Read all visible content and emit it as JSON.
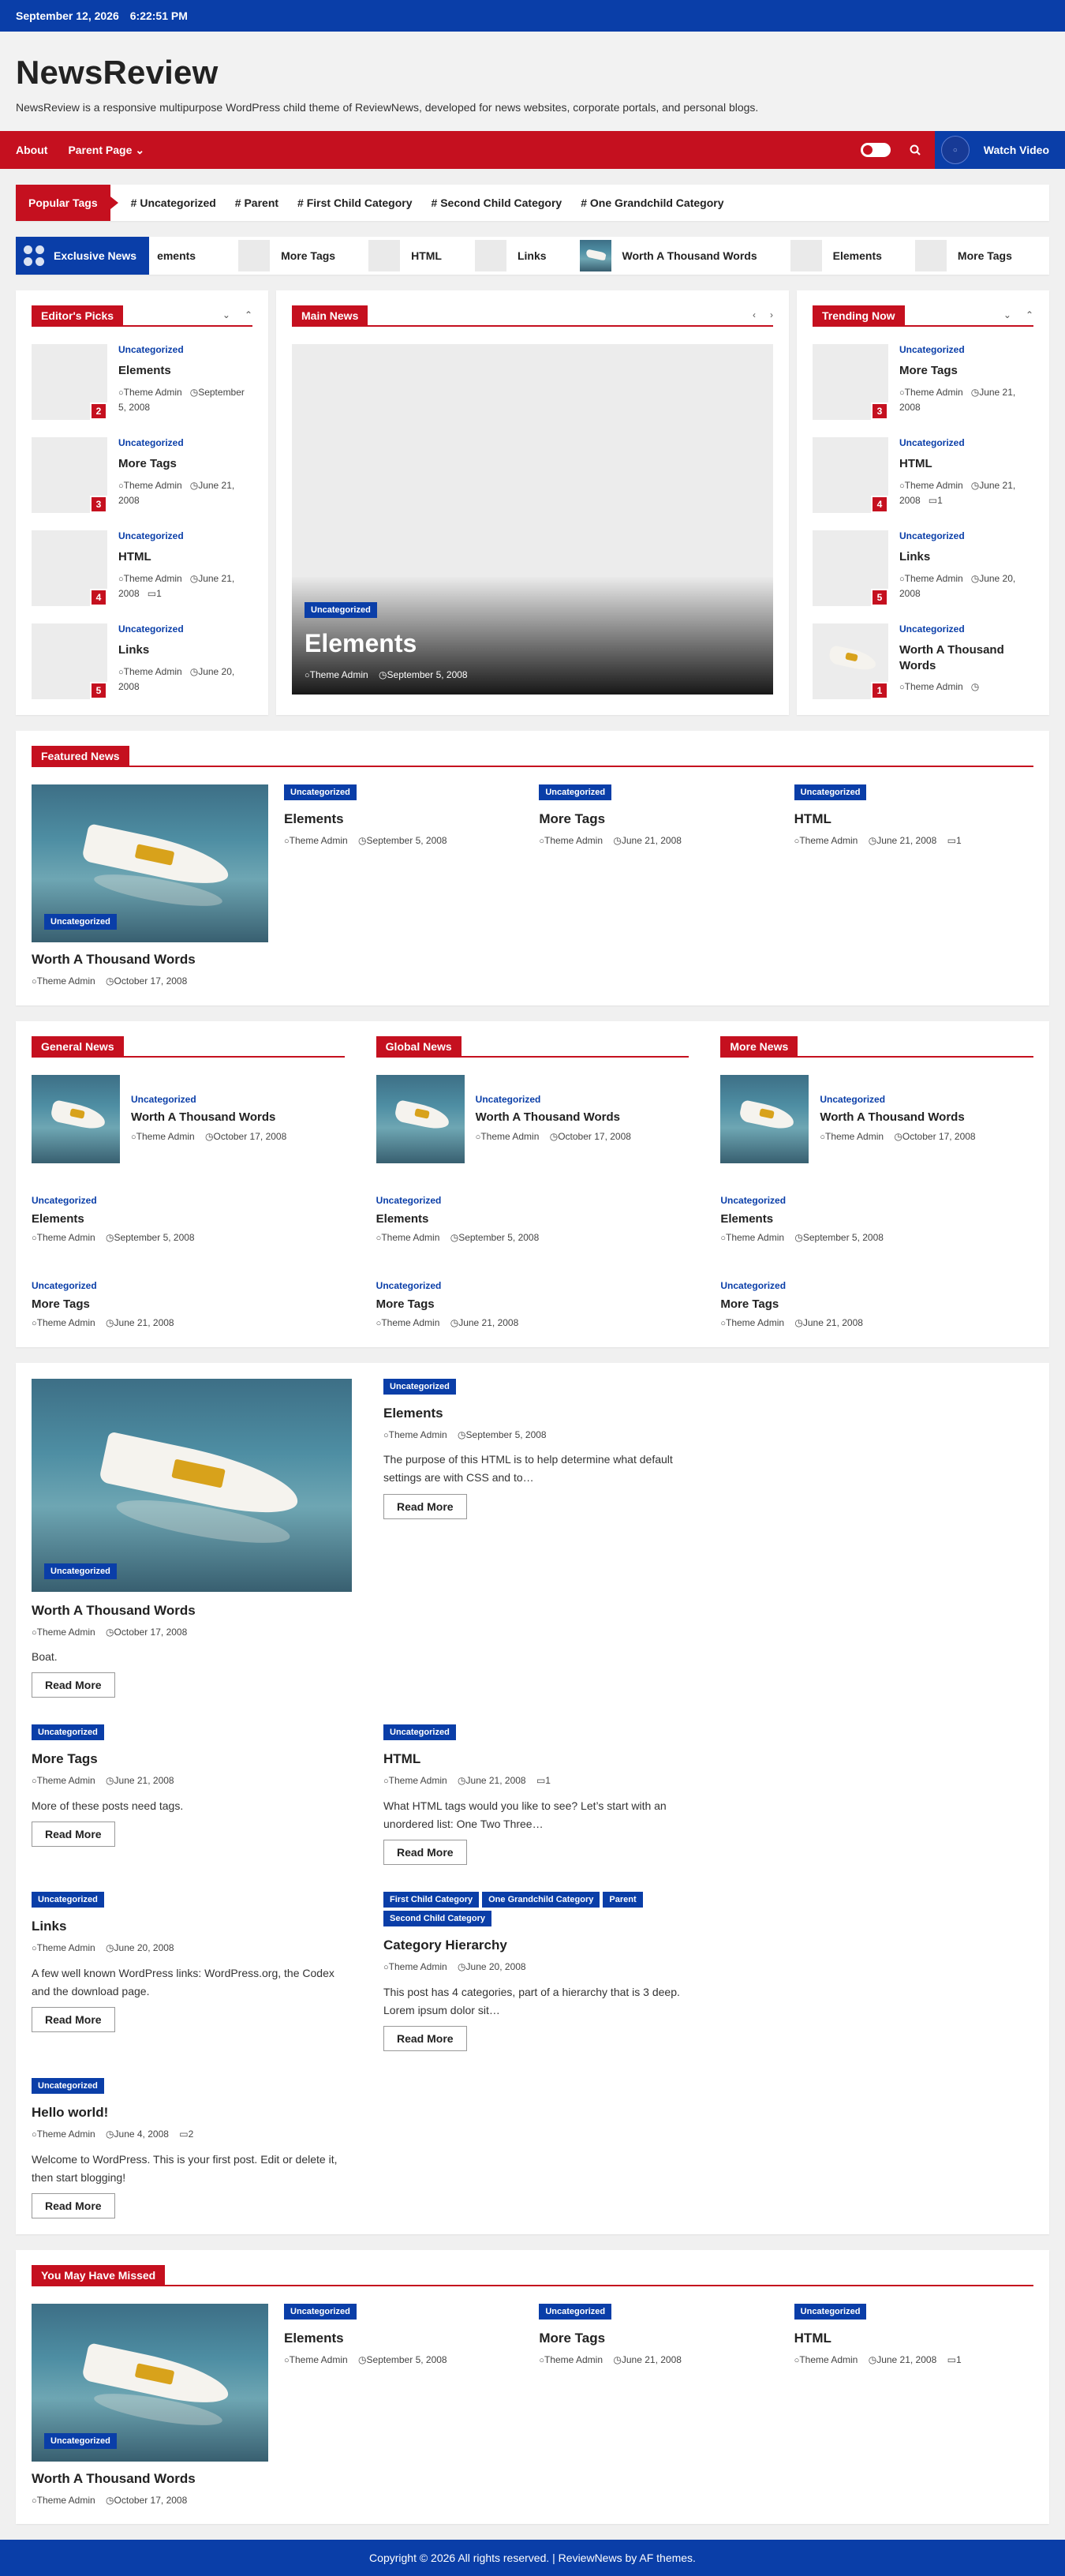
{
  "topbar": {
    "date": "September 12, 2026",
    "time": "6:22:51 PM"
  },
  "site": {
    "title": "NewsReview",
    "description": "NewsReview is a responsive multipurpose WordPress child theme of ReviewNews, developed for news websites, corporate portals, and personal blogs."
  },
  "nav": {
    "items": [
      "About",
      "Parent Page"
    ],
    "watch_label": "Watch Video"
  },
  "popular": {
    "label": "Popular Tags",
    "tags": [
      "# Uncategorized",
      "# Parent",
      "# First Child Category",
      "# Second Child Category",
      "# One Grandchild Category"
    ]
  },
  "ticker": {
    "label": "Exclusive News",
    "items": [
      "ements",
      "More Tags",
      "HTML",
      "Links",
      "Worth A Thousand Words",
      "Elements",
      "More Tags"
    ]
  },
  "editors": {
    "title": "Editor's Picks",
    "items": [
      {
        "cat": "Uncategorized",
        "title": "Elements",
        "author": "Theme Admin",
        "date": "September 5, 2008",
        "num": "2",
        "comments": ""
      },
      {
        "cat": "Uncategorized",
        "title": "More Tags",
        "author": "Theme Admin",
        "date": "June 21, 2008",
        "num": "3",
        "comments": ""
      },
      {
        "cat": "Uncategorized",
        "title": "HTML",
        "author": "Theme Admin",
        "date": "June 21, 2008",
        "num": "4",
        "comments": "1"
      },
      {
        "cat": "Uncategorized",
        "title": "Links",
        "author": "Theme Admin",
        "date": "June 20, 2008",
        "num": "5",
        "comments": ""
      }
    ]
  },
  "main_news": {
    "title": "Main News",
    "slide": {
      "cat": "Uncategorized",
      "title": "Elements",
      "author": "Theme Admin",
      "date": "September 5, 2008"
    }
  },
  "trending": {
    "title": "Trending Now",
    "items": [
      {
        "cat": "Uncategorized",
        "title": "More Tags",
        "author": "Theme Admin",
        "date": "June 21, 2008",
        "num": "3",
        "comments": ""
      },
      {
        "cat": "Uncategorized",
        "title": "HTML",
        "author": "Theme Admin",
        "date": "June 21, 2008",
        "num": "4",
        "comments": "1"
      },
      {
        "cat": "Uncategorized",
        "title": "Links",
        "author": "Theme Admin",
        "date": "June 20, 2008",
        "num": "5",
        "comments": ""
      },
      {
        "cat": "Uncategorized",
        "title": "Worth A Thousand Words",
        "author": "Theme Admin",
        "date": "",
        "num": "1",
        "comments": ""
      }
    ]
  },
  "featured": {
    "title": "Featured News",
    "big": {
      "cat": "Uncategorized",
      "title": "Worth A Thousand Words",
      "author": "Theme Admin",
      "date": "October 17, 2008"
    },
    "cols": [
      {
        "cat": "Uncategorized",
        "title": "Elements",
        "author": "Theme Admin",
        "date": "September 5, 2008",
        "comments": ""
      },
      {
        "cat": "Uncategorized",
        "title": "More Tags",
        "author": "Theme Admin",
        "date": "June 21, 2008",
        "comments": ""
      },
      {
        "cat": "Uncategorized",
        "title": "HTML",
        "author": "Theme Admin",
        "date": "June 21, 2008",
        "comments": "1"
      }
    ]
  },
  "sections": [
    {
      "title": "General News"
    },
    {
      "title": "Global News"
    },
    {
      "title": "More News"
    }
  ],
  "section_items": {
    "first": {
      "cat": "Uncategorized",
      "title": "Worth A Thousand Words",
      "author": "Theme Admin",
      "date": "October 17, 2008"
    },
    "second": {
      "cat": "Uncategorized",
      "title": "Elements",
      "author": "Theme Admin",
      "date": "September 5, 2008"
    },
    "third": {
      "cat": "Uncategorized",
      "title": "More Tags",
      "author": "Theme Admin",
      "date": "June 21, 2008"
    }
  },
  "posts": [
    {
      "cat": "Uncategorized",
      "title": "Worth A Thousand Words",
      "author": "Theme Admin",
      "date": "October 17, 2008",
      "excerpt": "Boat.",
      "more": "Read More"
    },
    {
      "cat": "Uncategorized",
      "title": "Elements",
      "author": "Theme Admin",
      "date": "September 5, 2008",
      "excerpt": "The purpose of this HTML is to help determine what default settings are with CSS and to…",
      "more": "Read More"
    },
    {
      "cat": "Uncategorized",
      "title": "More Tags",
      "author": "Theme Admin",
      "date": "June 21, 2008",
      "excerpt": "More of these posts need tags.",
      "more": "Read More"
    },
    {
      "cat": "Uncategorized",
      "title": "HTML",
      "author": "Theme Admin",
      "date": "June 21, 2008",
      "comments": "1",
      "excerpt": "What HTML tags would you like to see? Let’s start with an unordered list: One Two Three…",
      "more": "Read More"
    },
    {
      "cat": "Uncategorized",
      "title": "Links",
      "author": "Theme Admin",
      "date": "June 20, 2008",
      "excerpt": "A few well known WordPress links: WordPress.org, the Codex and the download page.",
      "more": "Read More"
    },
    {
      "cats": [
        "First Child Category",
        "One Grandchild Category",
        "Parent",
        "Second Child Category"
      ],
      "title": "Category Hierarchy",
      "author": "Theme Admin",
      "date": "June 20, 2008",
      "excerpt": "This post has 4 categories, part of a hierarchy that is 3 deep. Lorem ipsum dolor sit…",
      "more": "Read More"
    },
    {
      "cat": "Uncategorized",
      "title": "Hello world!",
      "author": "Theme Admin",
      "date": "June 4, 2008",
      "comments": "2",
      "excerpt": "Welcome to WordPress. This is your first post. Edit or delete it, then start blogging!",
      "more": "Read More"
    }
  ],
  "missed": {
    "title": "You May Have Missed"
  },
  "footer": {
    "text": "Copyright © 2026 All rights reserved. | ReviewNews by AF themes."
  },
  "colors": {
    "red": "#c5101f",
    "blue": "#0a3ea8"
  }
}
